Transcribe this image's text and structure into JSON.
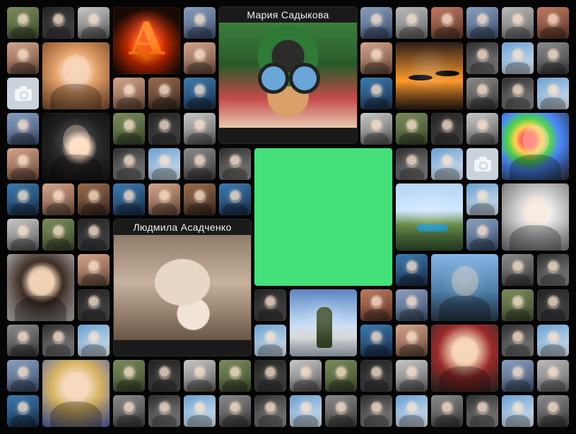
{
  "mosaic": {
    "featured_top": {
      "name": "Мария Садыкова",
      "colors": [
        "#3a7a3a",
        "#c44a4a",
        "#d9a06a",
        "#2b2b2b"
      ]
    },
    "featured_left": {
      "name": "Людмила Асадченко",
      "colors": [
        "#d7c9b7",
        "#a58a73",
        "#f1e6dc",
        "#6b5646"
      ]
    },
    "highlight_color": "#46e07a",
    "small_photos": [
      {
        "c1": "#7a8b5a",
        "c2": "#3d4a2c"
      },
      {
        "c1": "#d4a48a",
        "c2": "#6a4a3a"
      },
      {
        "c1": "#8aa0c0",
        "c2": "#3b4c6a"
      },
      {
        "c1": "#8a8a8a",
        "c2": "#3a3a3a"
      },
      {
        "c1": "#c9c9c9",
        "c2": "#5a5a5a"
      },
      {
        "c1": "#3a7ab0",
        "c2": "#1a2f4a"
      },
      {
        "c1": "#c07a60",
        "c2": "#5a3428"
      },
      {
        "c1": "#6aa0d0",
        "c2": "#e0e8f0"
      },
      {
        "c1": "#222222",
        "c2": "#4a4a4a"
      },
      {
        "c1": "#9a6a4a",
        "c2": "#3a2a22"
      },
      {
        "c1": "#b8b8b8",
        "c2": "#6a6a6a"
      },
      {
        "c1": "#2d2d2d",
        "c2": "#8a8a8a"
      }
    ]
  }
}
